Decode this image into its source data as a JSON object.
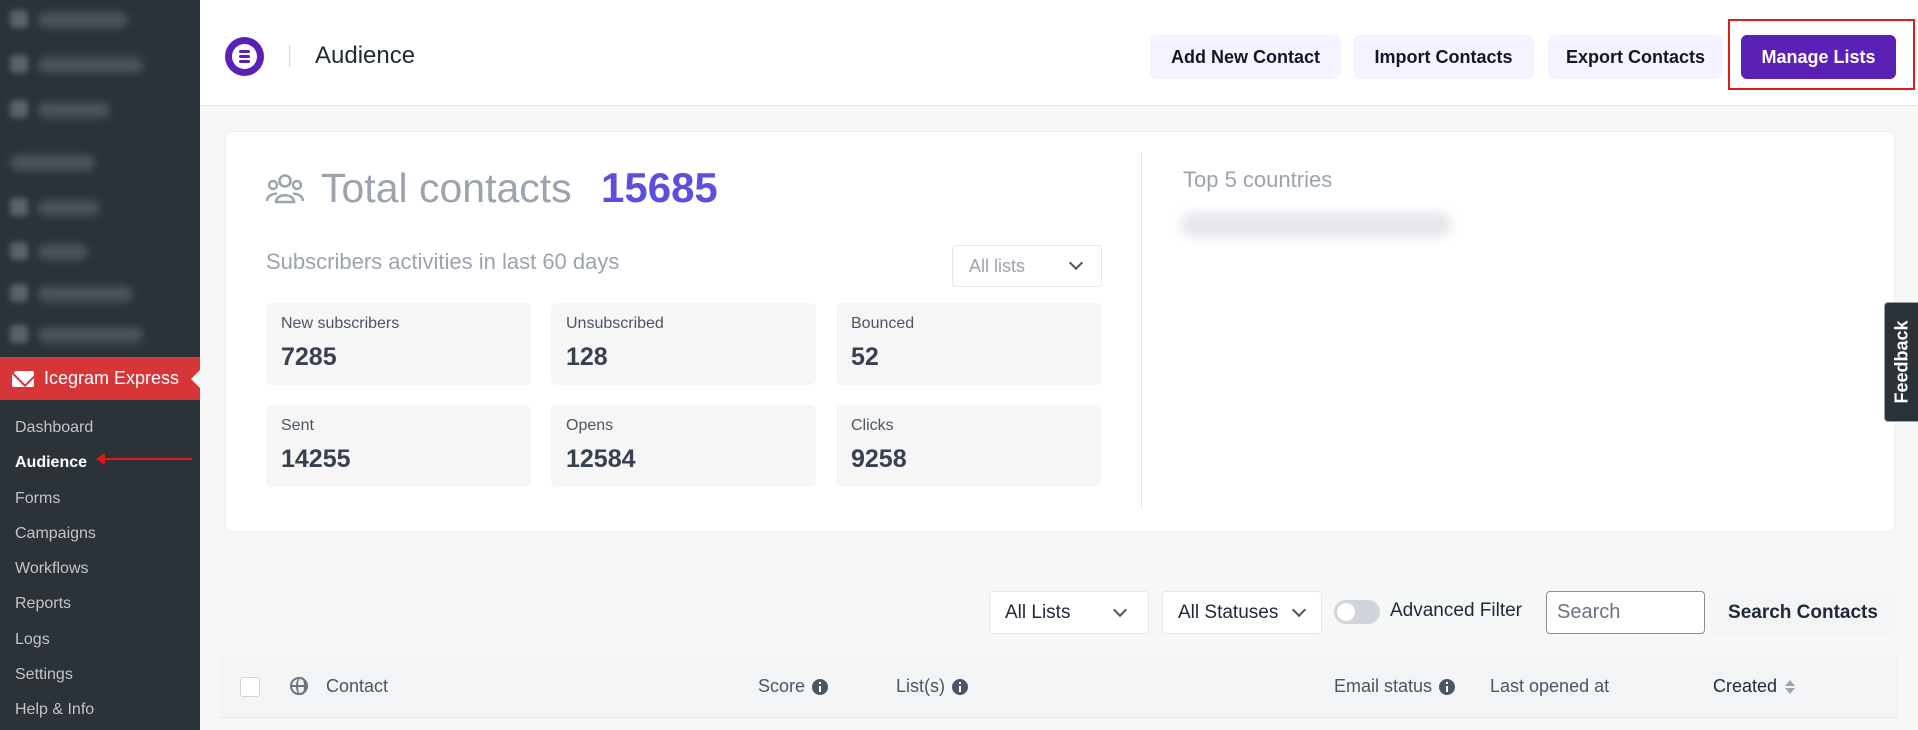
{
  "sidebar": {
    "plugin_label": "Icegram Express",
    "items": [
      {
        "label": "Dashboard"
      },
      {
        "label": "Audience"
      },
      {
        "label": "Forms"
      },
      {
        "label": "Campaigns"
      },
      {
        "label": "Workflows"
      },
      {
        "label": "Reports"
      },
      {
        "label": "Logs"
      },
      {
        "label": "Settings"
      },
      {
        "label": "Help & Info"
      }
    ],
    "active_item": "Audience"
  },
  "header": {
    "title": "Audience",
    "buttons": {
      "add_contact": "Add New Contact",
      "import_contacts": "Import Contacts",
      "export_contacts": "Export Contacts",
      "manage_lists": "Manage Lists"
    }
  },
  "stats": {
    "total_label": "Total contacts",
    "total_value": "15685",
    "activity_label": "Subscribers activities in last 60 days",
    "lists_filter": "All lists",
    "cards": [
      {
        "label": "New subscribers",
        "value": "7285"
      },
      {
        "label": "Unsubscribed",
        "value": "128"
      },
      {
        "label": "Bounced",
        "value": "52"
      },
      {
        "label": "Sent",
        "value": "14255"
      },
      {
        "label": "Opens",
        "value": "12584"
      },
      {
        "label": "Clicks",
        "value": "9258"
      }
    ],
    "countries_label": "Top 5 countries"
  },
  "feedback_label": "Feedback",
  "filters": {
    "lists": "All Lists",
    "statuses": "All Statuses",
    "advanced_filter": "Advanced Filter",
    "search_placeholder": "Search",
    "search_button": "Search Contacts"
  },
  "table": {
    "columns": {
      "contact": "Contact",
      "score": "Score",
      "lists": "List(s)",
      "email_status": "Email status",
      "last_opened": "Last opened at",
      "created": "Created"
    }
  },
  "colors": {
    "brand": "#5b21b6",
    "accent_number": "#5b4fe0",
    "sidebar": "#2c3338",
    "plugin_active": "#d63638",
    "annotation": "#e01919"
  }
}
